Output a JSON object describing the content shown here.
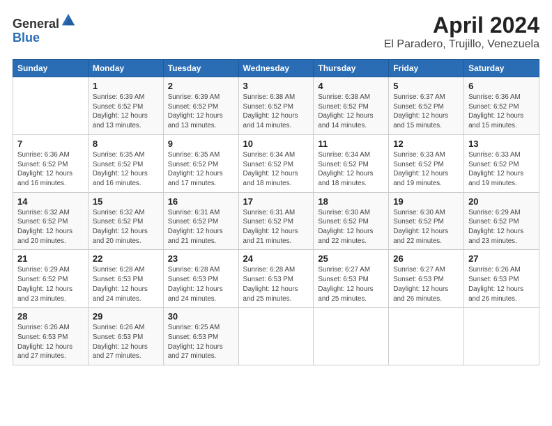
{
  "header": {
    "logo_general": "General",
    "logo_blue": "Blue",
    "month_title": "April 2024",
    "location": "El Paradero, Trujillo, Venezuela"
  },
  "days_of_week": [
    "Sunday",
    "Monday",
    "Tuesday",
    "Wednesday",
    "Thursday",
    "Friday",
    "Saturday"
  ],
  "weeks": [
    [
      {
        "day": "",
        "info": ""
      },
      {
        "day": "1",
        "info": "Sunrise: 6:39 AM\nSunset: 6:52 PM\nDaylight: 12 hours\nand 13 minutes."
      },
      {
        "day": "2",
        "info": "Sunrise: 6:39 AM\nSunset: 6:52 PM\nDaylight: 12 hours\nand 13 minutes."
      },
      {
        "day": "3",
        "info": "Sunrise: 6:38 AM\nSunset: 6:52 PM\nDaylight: 12 hours\nand 14 minutes."
      },
      {
        "day": "4",
        "info": "Sunrise: 6:38 AM\nSunset: 6:52 PM\nDaylight: 12 hours\nand 14 minutes."
      },
      {
        "day": "5",
        "info": "Sunrise: 6:37 AM\nSunset: 6:52 PM\nDaylight: 12 hours\nand 15 minutes."
      },
      {
        "day": "6",
        "info": "Sunrise: 6:36 AM\nSunset: 6:52 PM\nDaylight: 12 hours\nand 15 minutes."
      }
    ],
    [
      {
        "day": "7",
        "info": "Sunrise: 6:36 AM\nSunset: 6:52 PM\nDaylight: 12 hours\nand 16 minutes."
      },
      {
        "day": "8",
        "info": "Sunrise: 6:35 AM\nSunset: 6:52 PM\nDaylight: 12 hours\nand 16 minutes."
      },
      {
        "day": "9",
        "info": "Sunrise: 6:35 AM\nSunset: 6:52 PM\nDaylight: 12 hours\nand 17 minutes."
      },
      {
        "day": "10",
        "info": "Sunrise: 6:34 AM\nSunset: 6:52 PM\nDaylight: 12 hours\nand 18 minutes."
      },
      {
        "day": "11",
        "info": "Sunrise: 6:34 AM\nSunset: 6:52 PM\nDaylight: 12 hours\nand 18 minutes."
      },
      {
        "day": "12",
        "info": "Sunrise: 6:33 AM\nSunset: 6:52 PM\nDaylight: 12 hours\nand 19 minutes."
      },
      {
        "day": "13",
        "info": "Sunrise: 6:33 AM\nSunset: 6:52 PM\nDaylight: 12 hours\nand 19 minutes."
      }
    ],
    [
      {
        "day": "14",
        "info": "Sunrise: 6:32 AM\nSunset: 6:52 PM\nDaylight: 12 hours\nand 20 minutes."
      },
      {
        "day": "15",
        "info": "Sunrise: 6:32 AM\nSunset: 6:52 PM\nDaylight: 12 hours\nand 20 minutes."
      },
      {
        "day": "16",
        "info": "Sunrise: 6:31 AM\nSunset: 6:52 PM\nDaylight: 12 hours\nand 21 minutes."
      },
      {
        "day": "17",
        "info": "Sunrise: 6:31 AM\nSunset: 6:52 PM\nDaylight: 12 hours\nand 21 minutes."
      },
      {
        "day": "18",
        "info": "Sunrise: 6:30 AM\nSunset: 6:52 PM\nDaylight: 12 hours\nand 22 minutes."
      },
      {
        "day": "19",
        "info": "Sunrise: 6:30 AM\nSunset: 6:52 PM\nDaylight: 12 hours\nand 22 minutes."
      },
      {
        "day": "20",
        "info": "Sunrise: 6:29 AM\nSunset: 6:52 PM\nDaylight: 12 hours\nand 23 minutes."
      }
    ],
    [
      {
        "day": "21",
        "info": "Sunrise: 6:29 AM\nSunset: 6:52 PM\nDaylight: 12 hours\nand 23 minutes."
      },
      {
        "day": "22",
        "info": "Sunrise: 6:28 AM\nSunset: 6:53 PM\nDaylight: 12 hours\nand 24 minutes."
      },
      {
        "day": "23",
        "info": "Sunrise: 6:28 AM\nSunset: 6:53 PM\nDaylight: 12 hours\nand 24 minutes."
      },
      {
        "day": "24",
        "info": "Sunrise: 6:28 AM\nSunset: 6:53 PM\nDaylight: 12 hours\nand 25 minutes."
      },
      {
        "day": "25",
        "info": "Sunrise: 6:27 AM\nSunset: 6:53 PM\nDaylight: 12 hours\nand 25 minutes."
      },
      {
        "day": "26",
        "info": "Sunrise: 6:27 AM\nSunset: 6:53 PM\nDaylight: 12 hours\nand 26 minutes."
      },
      {
        "day": "27",
        "info": "Sunrise: 6:26 AM\nSunset: 6:53 PM\nDaylight: 12 hours\nand 26 minutes."
      }
    ],
    [
      {
        "day": "28",
        "info": "Sunrise: 6:26 AM\nSunset: 6:53 PM\nDaylight: 12 hours\nand 27 minutes."
      },
      {
        "day": "29",
        "info": "Sunrise: 6:26 AM\nSunset: 6:53 PM\nDaylight: 12 hours\nand 27 minutes."
      },
      {
        "day": "30",
        "info": "Sunrise: 6:25 AM\nSunset: 6:53 PM\nDaylight: 12 hours\nand 27 minutes."
      },
      {
        "day": "",
        "info": ""
      },
      {
        "day": "",
        "info": ""
      },
      {
        "day": "",
        "info": ""
      },
      {
        "day": "",
        "info": ""
      }
    ]
  ]
}
